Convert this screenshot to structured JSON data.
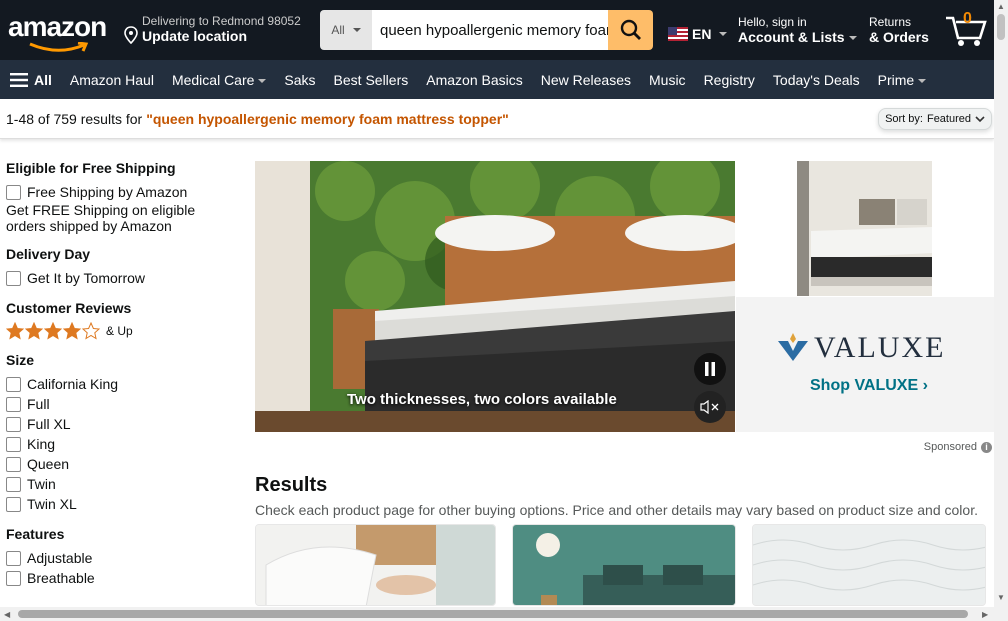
{
  "header": {
    "logo_text": "amazon",
    "deliver_line1": "Delivering to Redmond 98052",
    "deliver_line2": "Update location",
    "search_category": "All",
    "search_value": "queen hypoallergenic memory foam mattress topper",
    "lang": "EN",
    "account_line1": "Hello, sign in",
    "account_line2": "Account & Lists",
    "orders_line1": "Returns",
    "orders_line2": "& Orders",
    "cart_count": "0"
  },
  "nav": {
    "all": "All",
    "items": [
      "Amazon Haul",
      "Medical Care",
      "Saks",
      "Best Sellers",
      "Amazon Basics",
      "New Releases",
      "Music",
      "Registry",
      "Today's Deals",
      "Prime"
    ]
  },
  "results_bar": {
    "count": "1-48 of 759 results for",
    "query": "\"queen hypoallergenic memory foam mattress topper\"",
    "sort_label": "Sort by:",
    "sort_value": "Featured"
  },
  "sidebar": {
    "shipping_title": "Eligible for Free Shipping",
    "shipping_option": "Free Shipping by Amazon",
    "shipping_note": "Get FREE Shipping on eligible orders shipped by Amazon",
    "delivery_title": "Delivery Day",
    "delivery_option": "Get It by Tomorrow",
    "reviews_title": "Customer Reviews",
    "reviews_up": "& Up",
    "size_title": "Size",
    "sizes": [
      "California King",
      "Full",
      "Full XL",
      "King",
      "Queen",
      "Twin",
      "Twin XL"
    ],
    "features_title": "Features",
    "features": [
      "Adjustable",
      "Breathable"
    ]
  },
  "hero": {
    "caption": "Two thicknesses, two colors available"
  },
  "brand": {
    "name": "VALUXE",
    "shop": "Shop VALUXE ›",
    "sponsored": "Sponsored"
  },
  "results": {
    "title": "Results",
    "subtitle": "Check each product page for other buying options. Price and other details may vary based on product size and color."
  },
  "colors": {
    "nav_top": "#131921",
    "nav_main": "#232f3e",
    "search_button": "#febd69",
    "query": "#c45500",
    "link": "#007185",
    "star": "#de7921"
  }
}
